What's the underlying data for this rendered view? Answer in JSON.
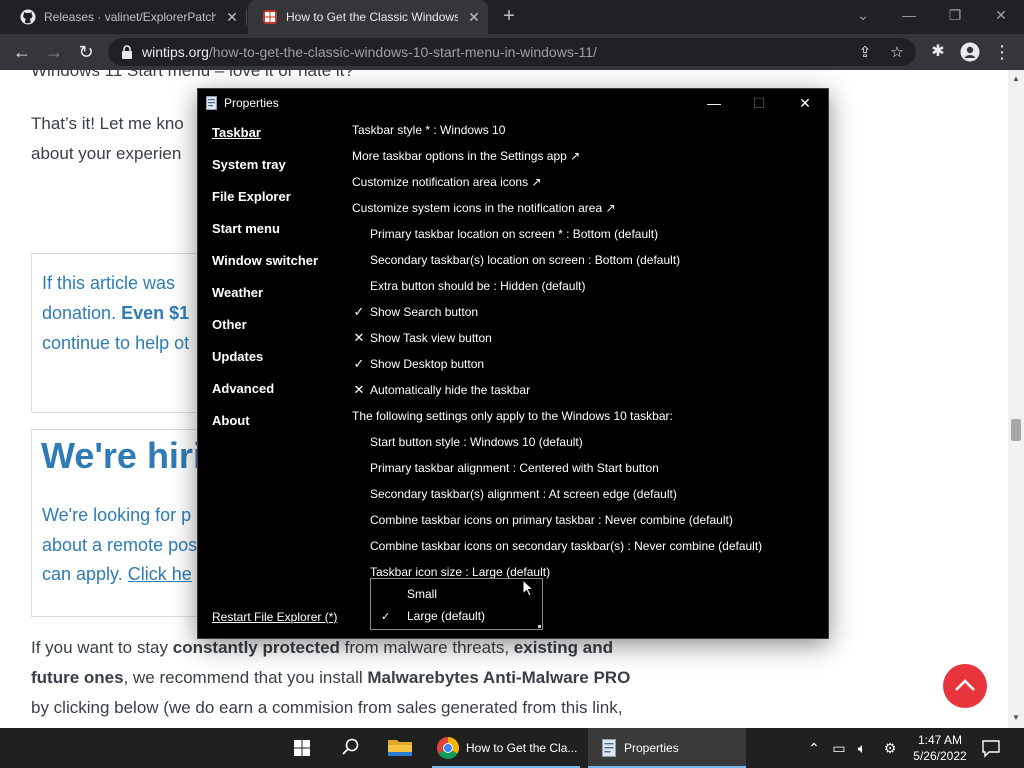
{
  "browser": {
    "tabs": [
      {
        "title": "Releases · valinet/ExplorerPatche",
        "icon": "github-icon"
      },
      {
        "title": "How to Get the Classic Windows",
        "icon": "wintips-icon"
      }
    ],
    "url_domain": "wintips.org",
    "url_path": "/how-to-get-the-classic-windows-10-start-menu-in-windows-11/"
  },
  "page": {
    "line_top": "Windows 11 Start menu – love it or hate it?",
    "para1_a": "That’s it! Let me kno",
    "para1_b": "about your experien",
    "donate_a": "If this article was",
    "donate_b_pre": "donation.",
    "donate_b_bold": "Even $1",
    "donate_c": "continue to help ot",
    "hiring_title": "We're hirin",
    "hiring_a": "We're looking for p",
    "hiring_b": "about a remote pos",
    "hiring_c_pre": "can apply.",
    "hiring_c_link": "Click he",
    "bottom_1_pre": "If you want to stay ",
    "bottom_1_bold1": "constantly protected",
    "bottom_1_mid": " from malware threats, ",
    "bottom_1_bold2": "existing and",
    "bottom_2_bold1": "future ones",
    "bottom_2_mid": ", we recommend that you install ",
    "bottom_2_bold2": "Malwarebytes Anti-Malware PRO",
    "bottom_3": "by clicking below (we do earn a commision from sales generated from this link,"
  },
  "dialog": {
    "title": "Properties",
    "nav": [
      "Taskbar",
      "System tray",
      "File Explorer",
      "Start menu",
      "Window switcher",
      "Weather",
      "Other",
      "Updates",
      "Advanced",
      "About"
    ],
    "restart_link": "Restart File Explorer (*)",
    "options": [
      {
        "text": "Taskbar style * : Windows 10",
        "indent": false,
        "mark": ""
      },
      {
        "text": "More taskbar options in the Settings app ↗",
        "indent": false,
        "mark": ""
      },
      {
        "text": "Customize notification area icons ↗",
        "indent": false,
        "mark": ""
      },
      {
        "text": "Customize system icons in the notification area ↗",
        "indent": false,
        "mark": ""
      },
      {
        "text": "Primary taskbar location on screen * : Bottom (default)",
        "indent": true,
        "mark": ""
      },
      {
        "text": "Secondary taskbar(s) location on screen : Bottom (default)",
        "indent": true,
        "mark": ""
      },
      {
        "text": "Extra button should be : Hidden (default)",
        "indent": true,
        "mark": ""
      },
      {
        "text": "Show Search button",
        "indent": true,
        "mark": "check"
      },
      {
        "text": "Show Task view button",
        "indent": true,
        "mark": "cross"
      },
      {
        "text": "Show Desktop button",
        "indent": true,
        "mark": "check"
      },
      {
        "text": "Automatically hide the taskbar",
        "indent": true,
        "mark": "cross"
      },
      {
        "text": "The following settings only apply to the Windows 10 taskbar:",
        "indent": false,
        "mark": ""
      },
      {
        "text": "Start button style : Windows 10 (default)",
        "indent": true,
        "mark": ""
      },
      {
        "text": "Primary taskbar alignment : Centered with Start button",
        "indent": true,
        "mark": ""
      },
      {
        "text": "Secondary taskbar(s) alignment : At screen edge (default)",
        "indent": true,
        "mark": ""
      },
      {
        "text": "Combine taskbar icons on primary taskbar : Never combine (default)",
        "indent": true,
        "mark": ""
      },
      {
        "text": "Combine taskbar icons on secondary taskbar(s) : Never combine (default)",
        "indent": true,
        "mark": ""
      },
      {
        "text": "Taskbar icon size : Large (default)",
        "indent": true,
        "mark": ""
      }
    ],
    "marks": {
      "check": "✓",
      "cross": "✕"
    },
    "dropdown": {
      "options": [
        "Small",
        "Large (default)"
      ],
      "selected_index": 1
    }
  },
  "taskbar": {
    "apps": [
      {
        "label": "How to Get the Cla...",
        "icon": "chrome-icon"
      },
      {
        "label": "Properties",
        "icon": "properties-icon"
      }
    ],
    "time": "1:47 AM",
    "date": "5/26/2022"
  },
  "colors": {
    "accent_blue": "#2f7bb6",
    "fab_red": "#e8353b",
    "dialog_bg": "#000000",
    "taskbar_bg": "#202020"
  }
}
